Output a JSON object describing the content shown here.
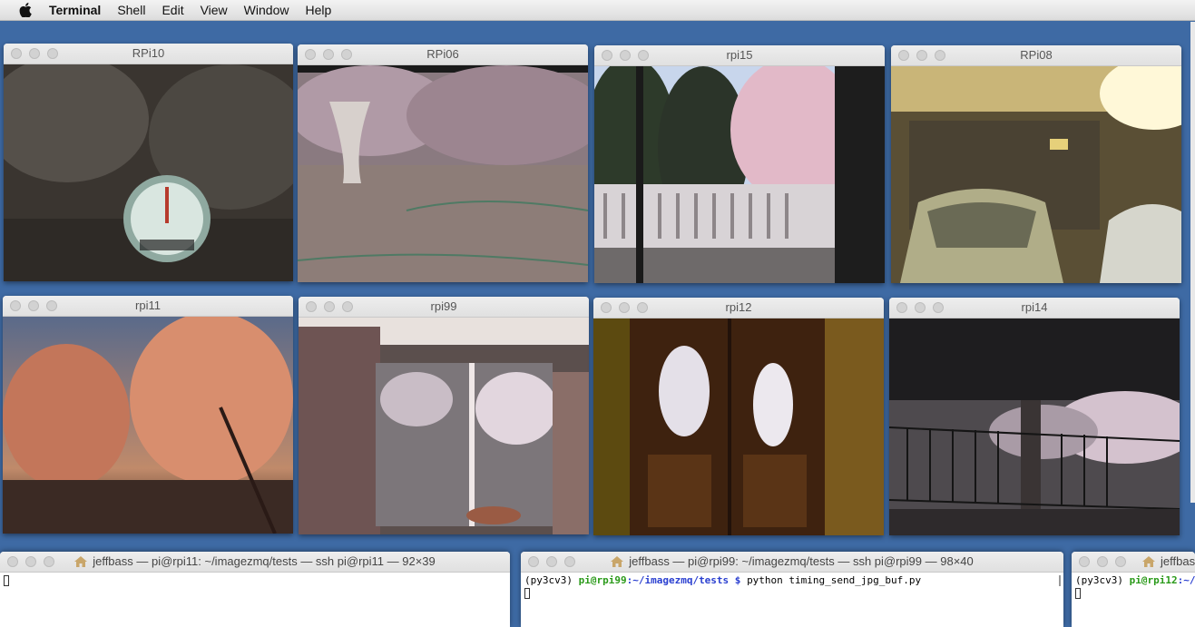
{
  "menubar": {
    "app": "Terminal",
    "items": [
      "Shell",
      "Edit",
      "View",
      "Window",
      "Help"
    ]
  },
  "windows": [
    {
      "title": "RPi10"
    },
    {
      "title": "RPi06"
    },
    {
      "title": "rpi15"
    },
    {
      "title": "RPi08"
    },
    {
      "title": "rpi11"
    },
    {
      "title": "rpi99"
    },
    {
      "title": "rpi12"
    },
    {
      "title": "rpi14"
    }
  ],
  "terminals": [
    {
      "title": "jeffbass — pi@rpi11: ~/imagezmq/tests — ssh pi@rpi11 — 92×39",
      "lines": []
    },
    {
      "title": "jeffbass — pi@rpi99: ~/imagezmq/tests — ssh pi@rpi99 — 98×40",
      "prompt_env": "(py3cv3)",
      "prompt_host": "pi@rpi99",
      "prompt_path": ":~/imagezmq/tests $",
      "command": "python timing_send_jpg_buf.py"
    },
    {
      "title": "jeffbas",
      "prompt_env": "(py3cv3)",
      "prompt_host": "pi@rpi12",
      "prompt_path": ":~/im"
    }
  ]
}
